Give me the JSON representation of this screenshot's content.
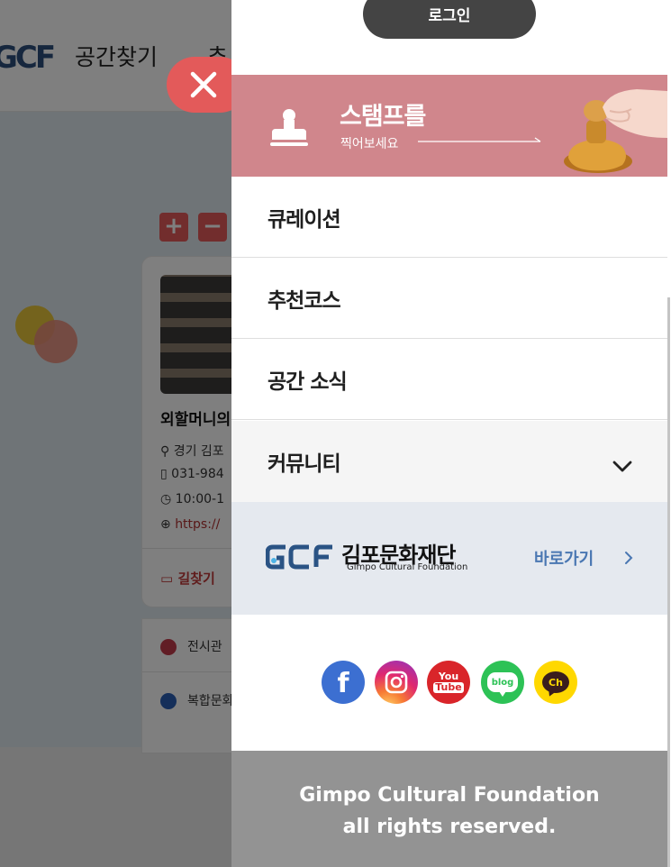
{
  "background": {
    "logo_text": "GCF",
    "nav": [
      "공간찾기",
      "추"
    ],
    "zoom_in": "+",
    "zoom_out": "−",
    "card": {
      "title": "외할머니의",
      "address": "경기 김포",
      "phone": "031-984",
      "hours": "10:00-1",
      "url": "https://",
      "route": "길찾기"
    },
    "legend": [
      "전시관",
      "복합문화"
    ],
    "colors": {
      "legend_1": "#c23a4a",
      "legend_2": "#2a5fb5",
      "accent": "#e35a5a"
    }
  },
  "close_button": {
    "icon": "close-icon"
  },
  "drawer": {
    "login_label": "로그인",
    "stamp": {
      "title": "스탬프를",
      "subtitle": "찍어보세요",
      "color": "#d0868c"
    },
    "menu": [
      {
        "label": "큐레이션"
      },
      {
        "label": "추천코스"
      },
      {
        "label": "공간 소식"
      },
      {
        "label": "커뮤니티",
        "expandable": true
      }
    ],
    "foundation": {
      "name_kr": "김포문화재단",
      "name_en": "Gimpo Cultural Foundation",
      "link_label": "바로가기"
    },
    "social": [
      {
        "name": "facebook-icon",
        "label": "f"
      },
      {
        "name": "instagram-icon"
      },
      {
        "name": "youtube-icon",
        "label_top": "You",
        "label_bottom": "Tube"
      },
      {
        "name": "blog-icon",
        "label": "blog"
      },
      {
        "name": "kakao-channel-icon",
        "label": "Ch"
      }
    ],
    "footer": {
      "line1": "Gimpo Cultural Foundation",
      "line2": "all rights reserved."
    }
  }
}
